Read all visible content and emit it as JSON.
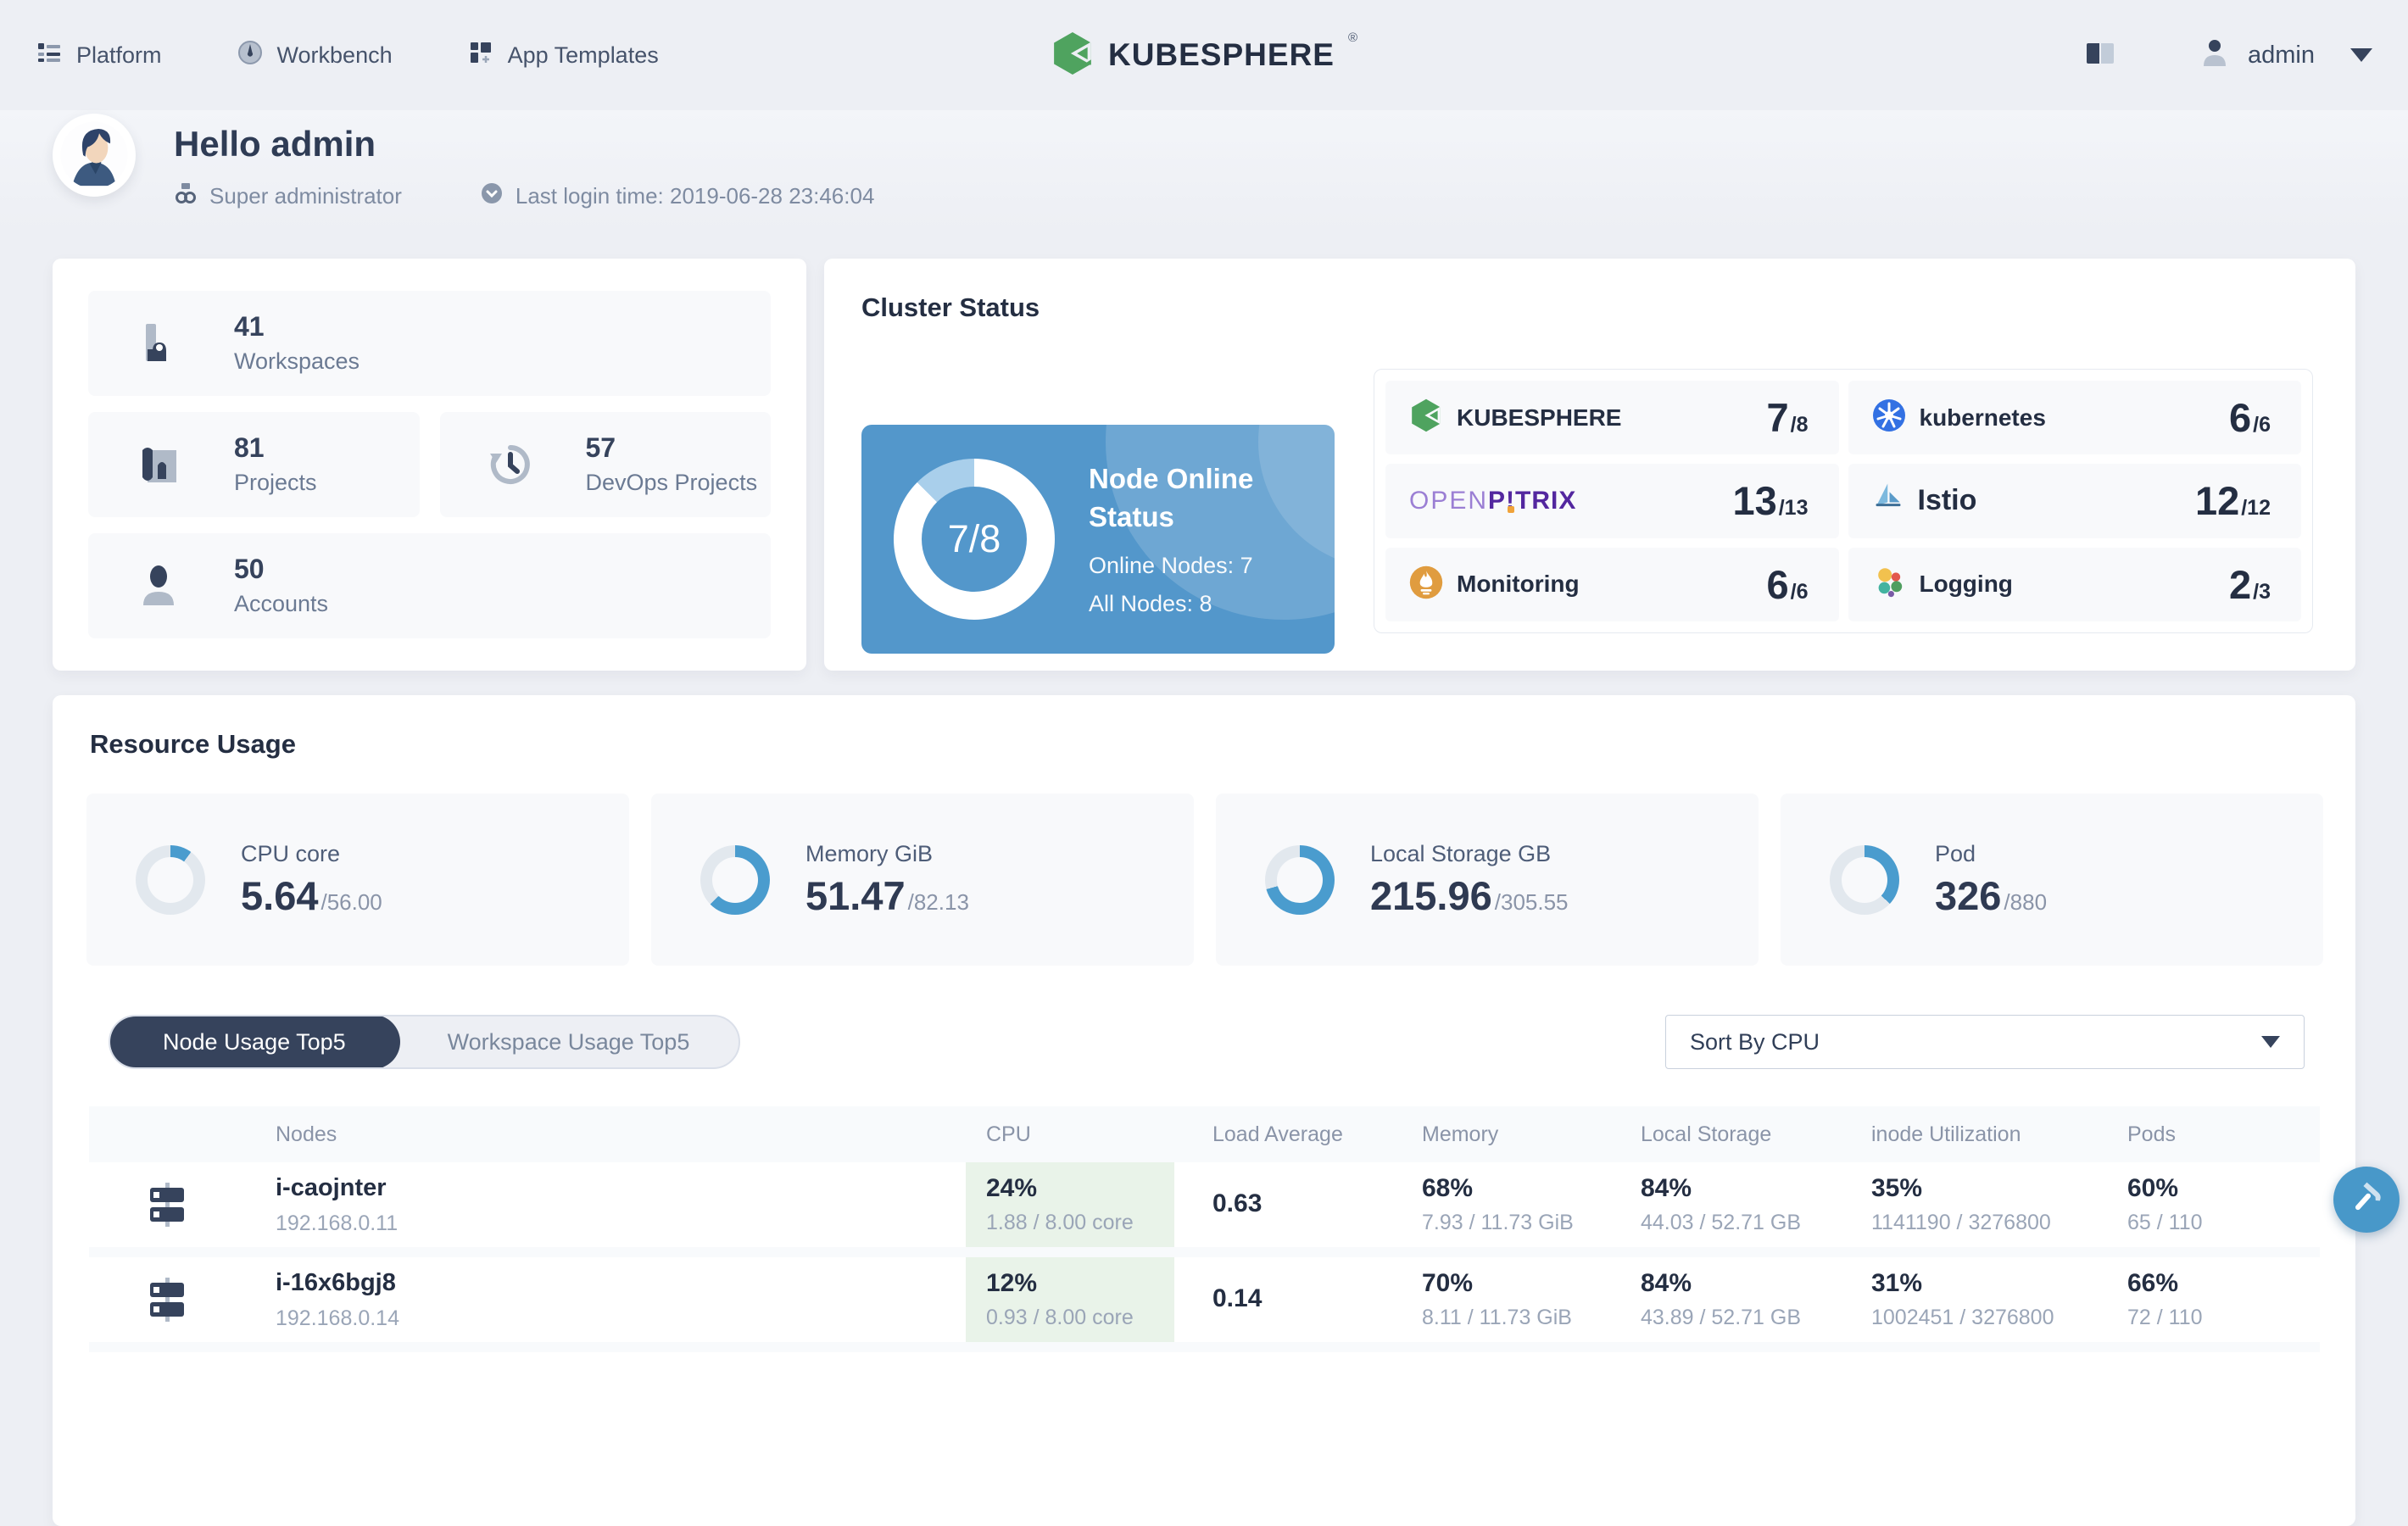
{
  "colors": {
    "white": "#ffffff",
    "accent_blue": "#4a9cce",
    "donut_track": "#e2e8ee",
    "cluster_panel": "#5397cb",
    "cluster_offline": "#a9cfeb",
    "active_tab": "#36435c",
    "cpu_cell_green": "#e9f3e9",
    "brand_green": "#4fa35f"
  },
  "nav": {
    "items": [
      {
        "label": "Platform"
      },
      {
        "label": "Workbench"
      },
      {
        "label": "App Templates"
      }
    ],
    "logo_text": "KUBESPHERE",
    "logo_reg": "®",
    "user": {
      "name": "admin"
    }
  },
  "hero": {
    "greeting": "Hello admin",
    "role": "Super administrator",
    "last_login": "Last login time: 2019-06-28 23:46:04"
  },
  "overview_stats": [
    {
      "value": "41",
      "label": "Workspaces"
    },
    {
      "value": "81",
      "label": "Projects"
    },
    {
      "value": "57",
      "label": "DevOps Projects"
    },
    {
      "value": "50",
      "label": "Accounts"
    }
  ],
  "cluster": {
    "title": "Cluster Status",
    "node_status": {
      "ratio": "7/8",
      "heading": "Node Online Status",
      "online_label": "Online Nodes: 7",
      "all_label": "All Nodes: 8",
      "online_pct": 87.5
    },
    "components": [
      {
        "name": "KUBESPHERE",
        "value": "7",
        "total": "/8"
      },
      {
        "name": "kubernetes",
        "value": "6",
        "total": "/6"
      },
      {
        "name_open": "OPEN",
        "name_p": "P",
        "name_bang": "!",
        "name_trix": "TRIX",
        "value": "13",
        "total": "/13"
      },
      {
        "name": "Istio",
        "value": "12",
        "total": "/12"
      },
      {
        "name": "Monitoring",
        "value": "6",
        "total": "/6"
      },
      {
        "name": "Logging",
        "value": "2",
        "total": "/3"
      }
    ]
  },
  "resources": {
    "title": "Resource Usage",
    "gauges": [
      {
        "label": "CPU core",
        "used": "5.64",
        "total": "/56.00",
        "pct": 10.1
      },
      {
        "label": "Memory GiB",
        "used": "51.47",
        "total": "/82.13",
        "pct": 62.7
      },
      {
        "label": "Local Storage GB",
        "used": "215.96",
        "total": "/305.55",
        "pct": 70.7
      },
      {
        "label": "Pod",
        "used": "326",
        "total": "/880",
        "pct": 37.0
      }
    ],
    "tabs": [
      {
        "label": "Node Usage Top5"
      },
      {
        "label": "Workspace Usage Top5"
      }
    ],
    "sort": {
      "value": "Sort By CPU"
    }
  },
  "table": {
    "columns": [
      "Nodes",
      "CPU",
      "Load Average",
      "Memory",
      "Local Storage",
      "inode Utilization",
      "Pods"
    ],
    "rows": [
      {
        "name": "i-caojnter",
        "ip": "192.168.0.11",
        "cpu_pct": "24%",
        "cpu_detail": "1.88 / 8.00 core",
        "load": "0.63",
        "mem_pct": "68%",
        "mem_detail": "7.93 / 11.73 GiB",
        "storage_pct": "84%",
        "storage_detail": "44.03 / 52.71 GB",
        "inode_pct": "35%",
        "inode_detail": "1141190 / 3276800",
        "pods_pct": "60%",
        "pods_detail": "65 / 110"
      },
      {
        "name": "i-16x6bgj8",
        "ip": "192.168.0.14",
        "cpu_pct": "12%",
        "cpu_detail": "0.93 / 8.00 core",
        "load": "0.14",
        "mem_pct": "70%",
        "mem_detail": "8.11 / 11.73 GiB",
        "storage_pct": "84%",
        "storage_detail": "43.89 / 52.71 GB",
        "inode_pct": "31%",
        "inode_detail": "1002451 / 3276800",
        "pods_pct": "66%",
        "pods_detail": "72 / 110"
      }
    ]
  }
}
